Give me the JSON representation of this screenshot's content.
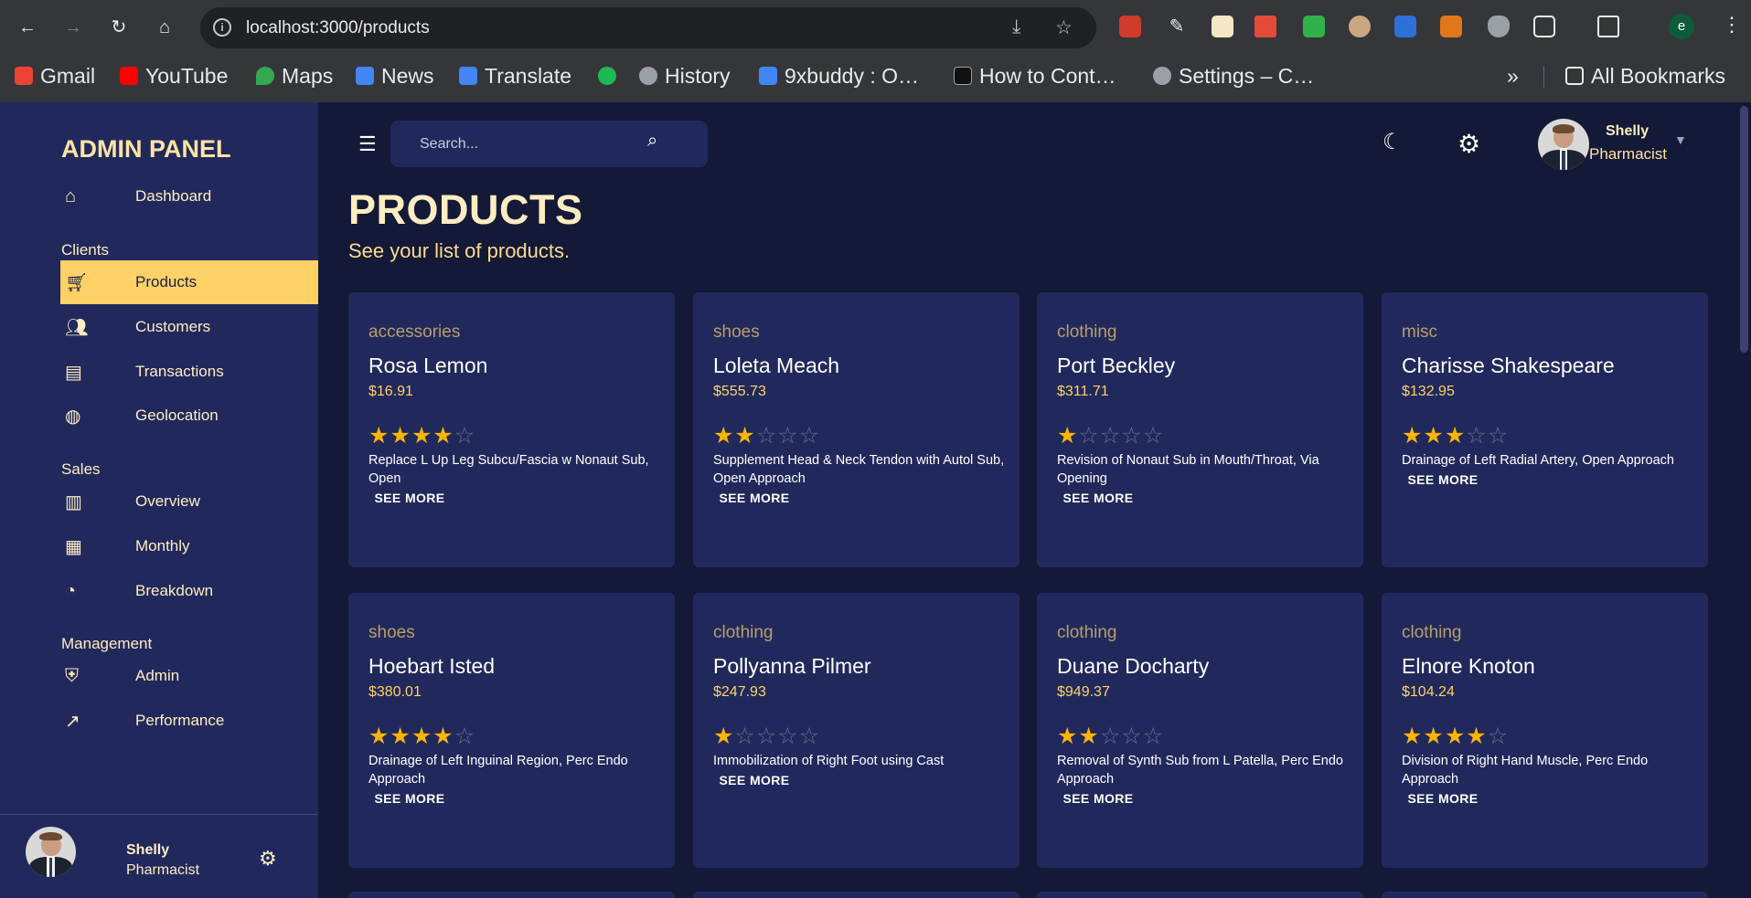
{
  "browser": {
    "url": "localhost:3000/products",
    "profile_initial": "e",
    "bookmarks": [
      "Gmail",
      "YouTube",
      "Maps",
      "News",
      "Translate",
      "",
      "History",
      "9xbuddy : O…",
      "How to Cont…",
      "Settings – C…"
    ],
    "bookmark_colors": [
      "#ea4335",
      "#ff0000",
      "#34a853",
      "#4285f4",
      "#4285f4",
      "#1db954",
      "#9aa0a6",
      "#4285f4",
      "#111111",
      "#9aa0a6"
    ],
    "all_bookmarks": "All Bookmarks"
  },
  "sidebar": {
    "brand": "ADMIN PANEL",
    "sections": {
      "clients": "Clients",
      "sales": "Sales",
      "management": "Management"
    },
    "items": [
      {
        "label": "Dashboard",
        "icon": "home-icon",
        "active": false
      },
      {
        "label": "Products",
        "icon": "cart-icon",
        "active": true
      },
      {
        "label": "Customers",
        "icon": "groups-icon",
        "active": false
      },
      {
        "label": "Transactions",
        "icon": "receipt-icon",
        "active": false
      },
      {
        "label": "Geolocation",
        "icon": "globe-icon",
        "active": false
      },
      {
        "label": "Overview",
        "icon": "point-of-sale-icon",
        "active": false
      },
      {
        "label": "Monthly",
        "icon": "calendar-icon",
        "active": false
      },
      {
        "label": "Breakdown",
        "icon": "pie-chart-icon",
        "active": false
      },
      {
        "label": "Admin",
        "icon": "admin-icon",
        "active": false
      },
      {
        "label": "Performance",
        "icon": "trending-up-icon",
        "active": false
      }
    ],
    "footer": {
      "name": "Shelly",
      "role": "Pharmacist"
    }
  },
  "topbar": {
    "search_placeholder": "Search...",
    "user_name": "Shelly",
    "user_role": "Pharmacist"
  },
  "header": {
    "title": "PRODUCTS",
    "subtitle": "See your list of products."
  },
  "products": [
    {
      "category": "accessories",
      "name": "Rosa Lemon",
      "price": "$16.91",
      "rating": 4,
      "description": "Replace L Up Leg Subcu/Fascia w Nonaut Sub, Open",
      "button": "SEE MORE"
    },
    {
      "category": "shoes",
      "name": "Loleta Meach",
      "price": "$555.73",
      "rating": 2,
      "description": "Supplement Head & Neck Tendon with Autol Sub, Open Approach",
      "button": "SEE MORE"
    },
    {
      "category": "clothing",
      "name": "Port Beckley",
      "price": "$311.71",
      "rating": 1,
      "description": "Revision of Nonaut Sub in Mouth/Throat, Via Opening",
      "button": "SEE MORE"
    },
    {
      "category": "misc",
      "name": "Charisse Shakespeare",
      "price": "$132.95",
      "rating": 3,
      "description": "Drainage of Left Radial Artery, Open Approach",
      "button": "SEE MORE"
    },
    {
      "category": "shoes",
      "name": "Hoebart Isted",
      "price": "$380.01",
      "rating": 4,
      "description": "Drainage of Left Inguinal Region, Perc Endo Approach",
      "button": "SEE MORE"
    },
    {
      "category": "clothing",
      "name": "Pollyanna Pilmer",
      "price": "$247.93",
      "rating": 1,
      "description": "Immobilization of Right Foot using Cast",
      "button": "SEE MORE"
    },
    {
      "category": "clothing",
      "name": "Duane Docharty",
      "price": "$949.37",
      "rating": 2,
      "description": "Removal of Synth Sub from L Patella, Perc Endo Approach",
      "button": "SEE MORE"
    },
    {
      "category": "clothing",
      "name": "Elnore Knoton",
      "price": "$104.24",
      "rating": 4,
      "description": "Division of Right Hand Muscle, Perc Endo Approach",
      "button": "SEE MORE"
    }
  ],
  "colors": {
    "background": "#141937",
    "panel": "#21295c",
    "accent": "#ffd166",
    "star": "#ffb400"
  }
}
